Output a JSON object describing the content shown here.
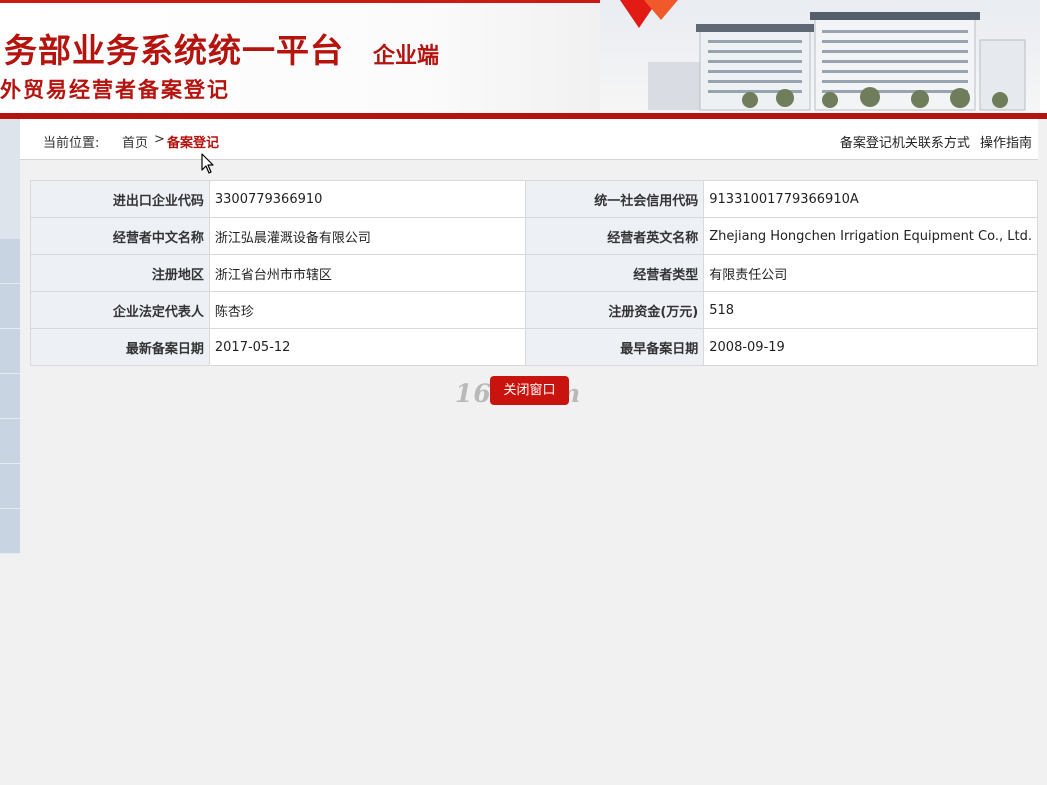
{
  "banner": {
    "title": "务部业务系统统一平台",
    "client": "企业端",
    "subtitle": "外贸易经营者备案登记"
  },
  "breadcrumb": {
    "label": "当前位置:",
    "home": "首页",
    "separator": ">",
    "current": "备案登记",
    "contact_link": "备案登记机关联系方式",
    "guide_link": "操作指南"
  },
  "info": {
    "rows": [
      {
        "label1": "进出口企业代码",
        "value1": "3300779366910",
        "label2": "统一社会信用代码",
        "value2": "91331001779366910A"
      },
      {
        "label1": "经营者中文名称",
        "value1": "浙江弘晨灌溉设备有限公司",
        "label2": "经营者英文名称",
        "value2": "Zhejiang Hongchen Irrigation Equipment Co., Ltd."
      },
      {
        "label1": "注册地区",
        "value1": "浙江省台州市市辖区",
        "label2": "经营者类型",
        "value2": "有限责任公司"
      },
      {
        "label1": "企业法定代表人",
        "value1": "陈杏珍",
        "label2": "注册资金(万元)",
        "value2": "518"
      },
      {
        "label1": "最新备案日期",
        "value1": "2017-05-12",
        "label2": "最早备案日期",
        "value2": "2008-09-19"
      }
    ]
  },
  "actions": {
    "close_label": "关闭窗口"
  },
  "watermark": "168.com",
  "colors": {
    "brand_red": "#b5130e",
    "button_red": "#c8130f",
    "label_bg": "#edf1f6",
    "page_bg": "#f1f1f1"
  }
}
